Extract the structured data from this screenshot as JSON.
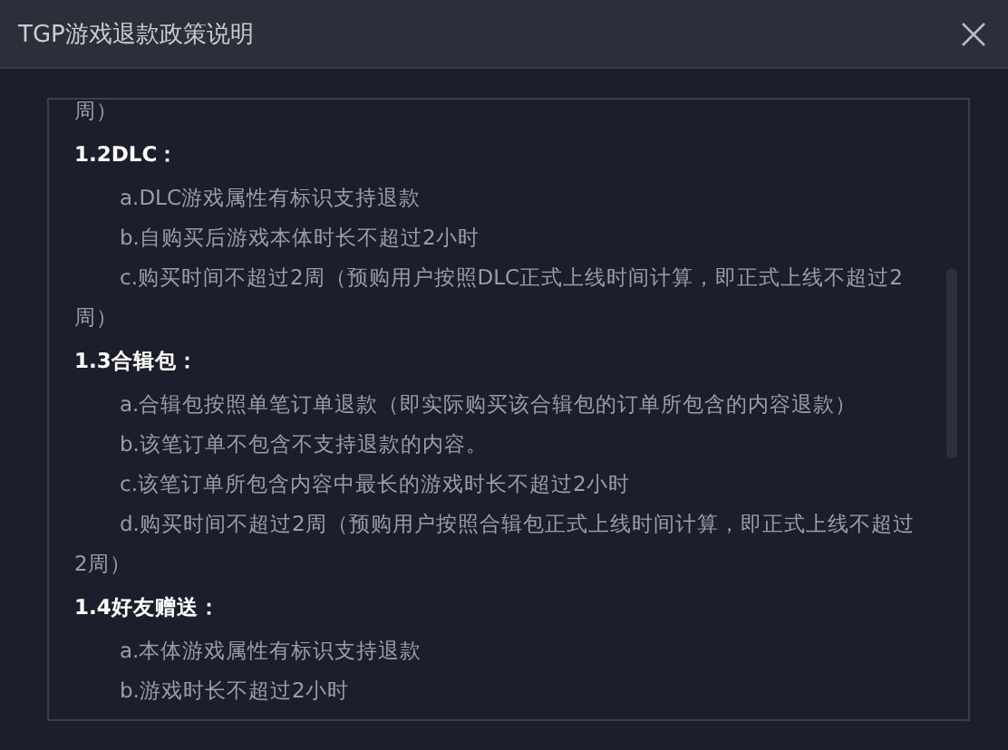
{
  "window": {
    "title": "TGP游戏退款政策说明"
  },
  "paragraphs": [
    {
      "kind": "continuation",
      "text": "周）"
    },
    {
      "kind": "heading",
      "text": "1.2DLC："
    },
    {
      "kind": "item",
      "text": "a.DLC游戏属性有标识支持退款"
    },
    {
      "kind": "item",
      "text": "b.自购买后游戏本体时长不超过2小时"
    },
    {
      "kind": "item",
      "text": "c.购买时间不超过2周（预购用户按照DLC正式上线时间计算，即正式上线不超过2周）"
    },
    {
      "kind": "heading",
      "text": "1.3合辑包："
    },
    {
      "kind": "item",
      "text": "a.合辑包按照单笔订单退款（即实际购买该合辑包的订单所包含的内容退款）"
    },
    {
      "kind": "item",
      "text": "b.该笔订单不包含不支持退款的内容。"
    },
    {
      "kind": "item",
      "text": "c.该笔订单所包含内容中最长的游戏时长不超过2小时"
    },
    {
      "kind": "item",
      "text": "d.购买时间不超过2周（预购用户按照合辑包正式上线时间计算，即正式上线不超过2周）"
    },
    {
      "kind": "heading",
      "text": "1.4好友赠送："
    },
    {
      "kind": "item",
      "text": "a.本体游戏属性有标识支持退款"
    },
    {
      "kind": "item",
      "text": "b.游戏时长不超过2小时"
    }
  ]
}
